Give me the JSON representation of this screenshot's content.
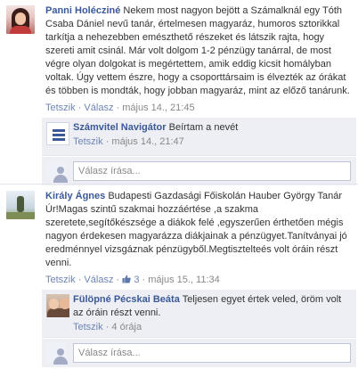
{
  "thread1": {
    "author": "Panni Holécziné",
    "text": "Nekem most nagyon bejött a Számalknál egy Tóth Csaba Dániel nevű tanár, értelmesen magyaráz, humoros sztorikkal tarkítja a nehezebben emészthető részeket és látszik rajta, hogy szereti amit csinál. Már volt dolgom 1-2 pénzügy tanárral, de most végre olyan dolgokat is megértettem, amik eddig kicsit homályban voltak. Úgy vettem észre, hogy a csoporttársaim is élvezték az órákat és többen is mondták, hogy jobban magyaráz, mint az előző tanárunk.",
    "actions": {
      "like": "Tetszik",
      "reply": "Válasz",
      "separator": "·",
      "time": "május 14., 21:45"
    },
    "reply": {
      "author": "Számvitel Navigátor",
      "text": "Beírtam a nevét",
      "actions": {
        "like": "Tetszik",
        "separator": "·",
        "time": "május 14., 21:47"
      }
    },
    "compose_placeholder": "Válasz írása..."
  },
  "thread2": {
    "author": "Király Ágnes",
    "text": "Budapesti Gazdasági Főiskolán Hauber György Tanár Úr!Magas szintű szakmai hozzáértése ,a szakma szeretete,segítőkészsége a diákok felé ,egyszerűen érthetően mégis nagyon érdekesen magyarázza diákjainak a pénzügyet.Tanítványai jó eredménnyel vizsgáznak pénzügyből.Megtisztelteés volt óráin részt venni.",
    "actions": {
      "like": "Tetszik",
      "reply": "Válasz",
      "separator": "·",
      "like_count": "3",
      "time": "május 15., 11:34"
    },
    "reply": {
      "author": "Fülöpné Pécskai Beáta",
      "text": "Teljesen egyet értek veled, öröm volt az óráin részt venni.",
      "actions": {
        "like": "Tetszik",
        "separator": "·",
        "time": "4 órája"
      }
    },
    "compose_placeholder": "Válasz írása..."
  },
  "colors": {
    "link": "#3b5998",
    "meta_link": "#6d84b4",
    "reply_bg": "#edeff4"
  }
}
